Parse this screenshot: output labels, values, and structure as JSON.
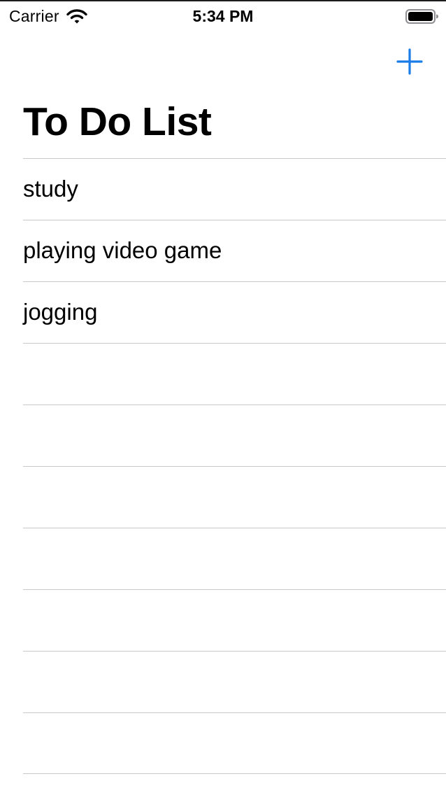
{
  "status_bar": {
    "carrier": "Carrier",
    "time": "5:34 PM",
    "wifi_icon": "wifi-icon",
    "battery_icon": "battery-icon"
  },
  "nav": {
    "add_icon": "plus-icon",
    "accent_color": "#1a7ce6"
  },
  "title": "To Do List",
  "todos": [
    {
      "label": "study"
    },
    {
      "label": "playing video game"
    },
    {
      "label": "jogging"
    },
    {
      "label": ""
    },
    {
      "label": ""
    },
    {
      "label": ""
    },
    {
      "label": ""
    },
    {
      "label": ""
    },
    {
      "label": ""
    },
    {
      "label": ""
    }
  ]
}
